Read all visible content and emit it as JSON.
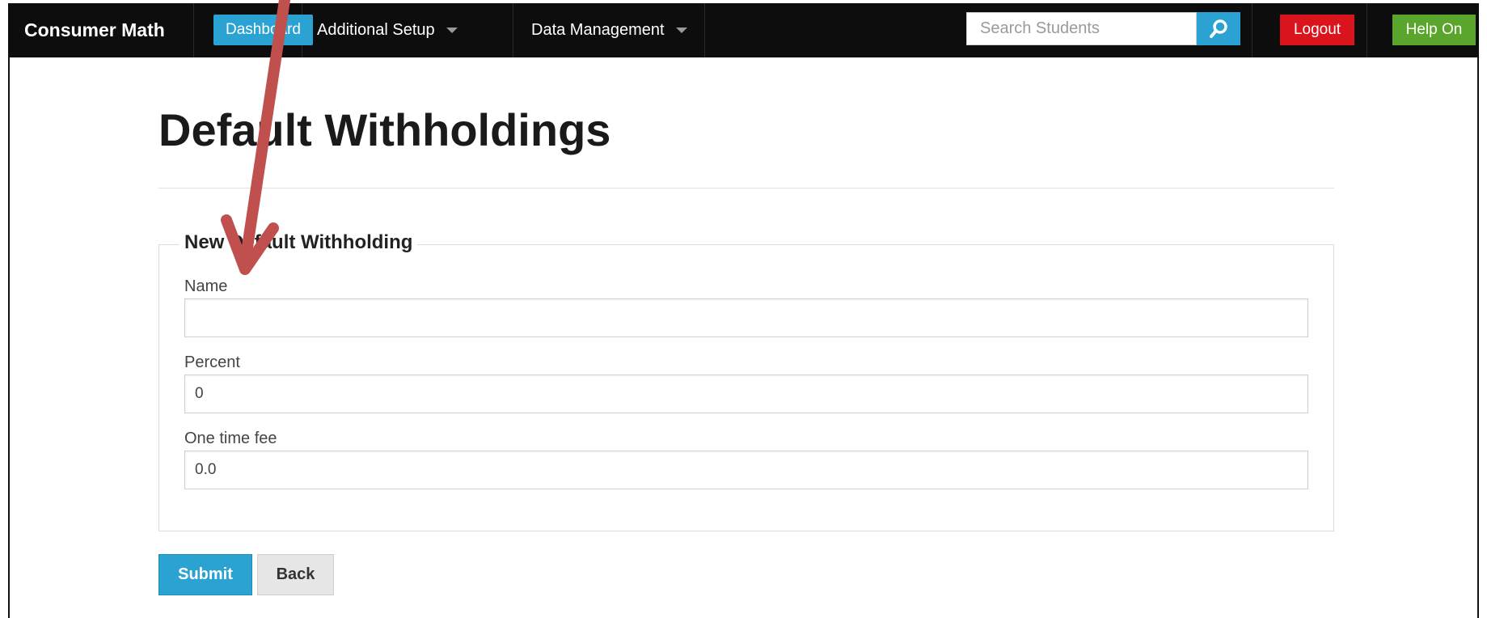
{
  "navbar": {
    "brand": "Consumer Math",
    "dashboard_label": "Dashboard",
    "menus": [
      {
        "label": "Additional Setup"
      },
      {
        "label": "Data Management"
      }
    ],
    "search": {
      "placeholder": "Search Students",
      "value": ""
    },
    "logout_label": "Logout",
    "help_label": "Help On"
  },
  "page": {
    "title": "Default Withholdings"
  },
  "form": {
    "legend": "New Default Withholding",
    "fields": [
      {
        "label": "Name",
        "value": ""
      },
      {
        "label": "Percent",
        "value": "0"
      },
      {
        "label": "One time fee",
        "value": "0.0"
      }
    ],
    "submit_label": "Submit",
    "back_label": "Back"
  },
  "colors": {
    "navbar_bg": "#0d0d0d",
    "primary": "#2aa3d2",
    "logout": "#d9141c",
    "help": "#5aa52b",
    "annotation_arrow": "#c0504d"
  },
  "icons": {
    "search": "magnifier-icon",
    "dropdown": "caret-down-icon",
    "annotation": "annotation-arrow"
  }
}
